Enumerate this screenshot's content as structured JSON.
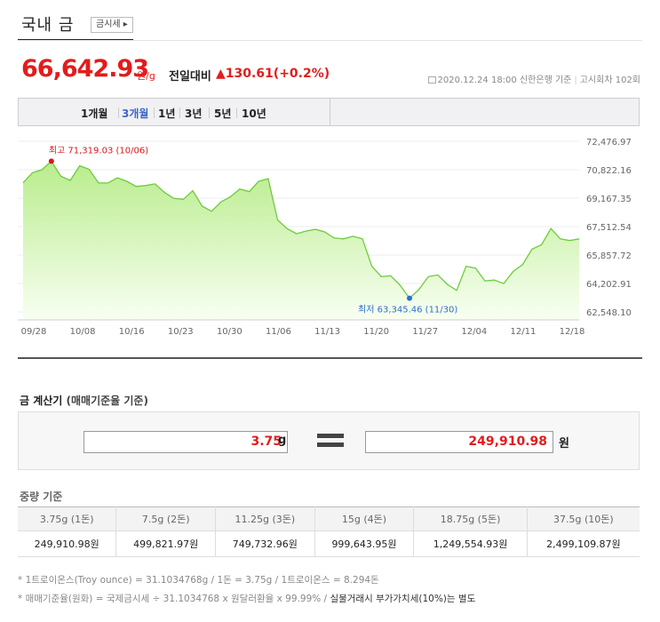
{
  "header": {
    "title": "국내 금",
    "tag_button": "금시세 ▸"
  },
  "price": {
    "value": "66,642.93",
    "unit": "원/g",
    "prev_label": "전일대비",
    "change": "▲130.61(+0.2%)"
  },
  "meta": {
    "datetime": "2020.12.24 18:00",
    "source": "신한은행 기준",
    "round": "고시회차 102회"
  },
  "periods": [
    {
      "label": "1개월"
    },
    {
      "label": "3개월",
      "active": true
    },
    {
      "label": "1년"
    },
    {
      "label": "3년"
    },
    {
      "label": "5년"
    },
    {
      "label": "10년"
    }
  ],
  "chart_data": {
    "type": "area",
    "x_ticks": [
      "09/28",
      "10/08",
      "10/16",
      "10/23",
      "10/30",
      "11/06",
      "11/13",
      "11/20",
      "11/27",
      "12/04",
      "12/11",
      "12/18"
    ],
    "y_ticks": [
      "72,476.97",
      "70,822.16",
      "69,167.35",
      "67,512.54",
      "65,857.72",
      "64,202.91",
      "62,548.10"
    ],
    "ylim": [
      62548.1,
      72476.97
    ],
    "grid": true,
    "values": [
      70060,
      70650,
      70820,
      71319.03,
      70450,
      70200,
      71050,
      70850,
      70050,
      70050,
      70350,
      70150,
      69850,
      69900,
      70000,
      69500,
      69150,
      69100,
      69600,
      68700,
      68400,
      68950,
      69250,
      69700,
      69550,
      70150,
      70300,
      67900,
      67400,
      67100,
      67250,
      67350,
      67200,
      66850,
      66800,
      66950,
      66800,
      65200,
      64600,
      64650,
      64100,
      63345.46,
      63850,
      64600,
      64700,
      64150,
      63800,
      65200,
      65100,
      64350,
      64400,
      64200,
      64900,
      65300,
      66200,
      66450,
      67400,
      66800,
      66700,
      66800
    ],
    "high": {
      "label": "최고 71,319.03 (10/06)",
      "index": 3
    },
    "low": {
      "label": "최저 63,345.46 (11/30)",
      "index": 41
    },
    "colors": {
      "line": "#6ccc3c",
      "fill_top": "#b9ec8c",
      "high": "#d81818",
      "low": "#2b6fd0"
    }
  },
  "calculator": {
    "title": "금 계산기",
    "subtitle": "(매매기준율 기준)",
    "weight_value": "3.75",
    "weight_unit": "g",
    "result_value": "249,910.98",
    "result_unit": "원"
  },
  "weight_table": {
    "title": "중량 기준",
    "headers": [
      "3.75g (1돈)",
      "7.5g (2돈)",
      "11.25g (3돈)",
      "15g (4돈)",
      "18.75g (5돈)",
      "37.5g (10돈)"
    ],
    "values": [
      "249,910.98원",
      "499,821.97원",
      "749,732.96원",
      "999,643.95원",
      "1,249,554.93원",
      "2,499,109.87원"
    ]
  },
  "notes": {
    "line1": "* 1트로이온스(Troy ounce) = 31.1034768g / 1돈 = 3.75g / 1트로이온스 = 8.294돈",
    "line2_prefix": "* 매매기준율(원화) = 국제금시세 ÷ 31.1034768 x 원달러환율 x 99.99% / ",
    "line2_strong": "실물거래시 부가가치세(10%)는 별도"
  }
}
